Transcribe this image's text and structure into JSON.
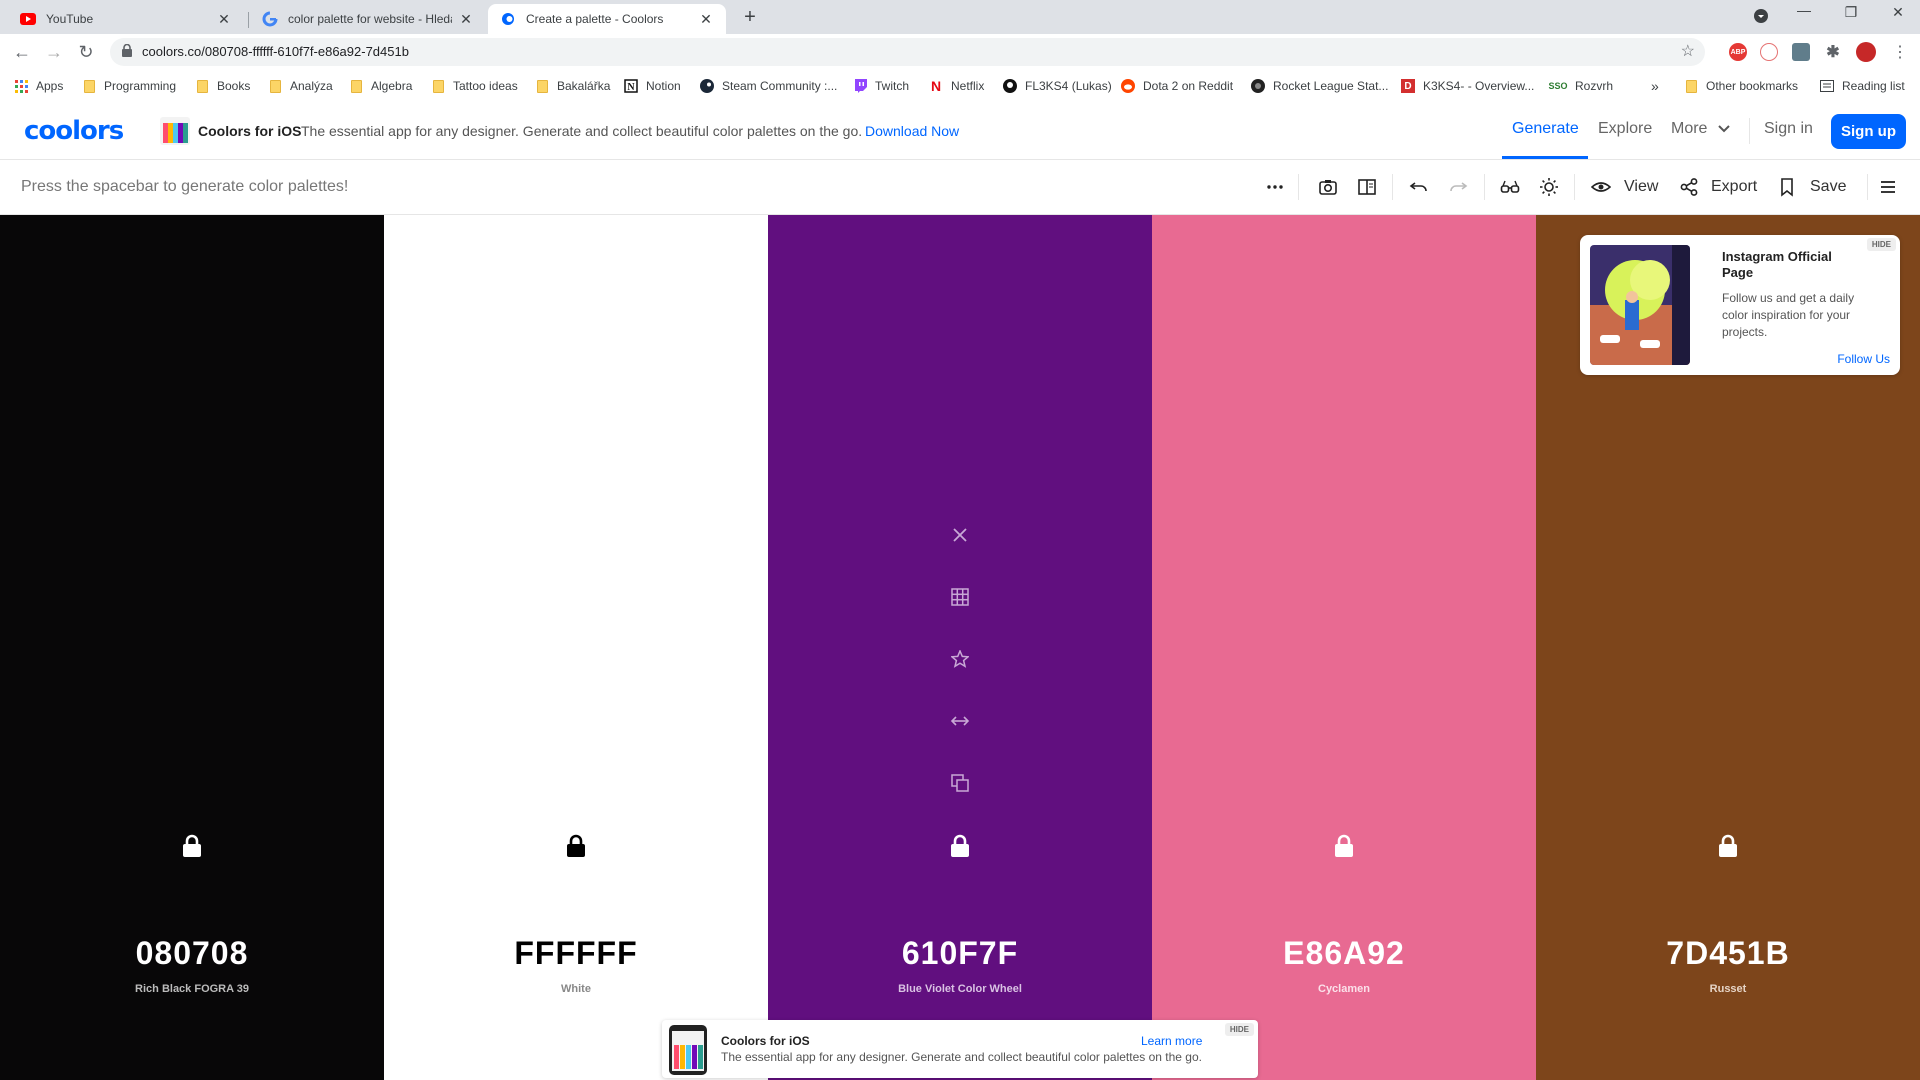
{
  "browser": {
    "tabs": [
      {
        "title": "YouTube",
        "favicon": "youtube-icon",
        "active": false
      },
      {
        "title": "color palette for website - Hledat",
        "favicon": "google-icon",
        "active": false
      },
      {
        "title": "Create a palette - Coolors",
        "favicon": "coolors-icon",
        "active": true
      }
    ],
    "new_tab": "+",
    "url": "coolors.co/080708-ffffff-610f7f-e86a92-7d451b",
    "extensions": [
      "ABP",
      "ext-2",
      "ext-3",
      "puzzle-icon",
      "profile-avatar"
    ],
    "bookmarks": [
      {
        "label": "Apps",
        "icon": "apps-grid-icon"
      },
      {
        "label": "Programming",
        "icon": "folder-icon"
      },
      {
        "label": "Books",
        "icon": "folder-icon"
      },
      {
        "label": "Analýza",
        "icon": "folder-icon"
      },
      {
        "label": "Algebra",
        "icon": "folder-icon"
      },
      {
        "label": "Tattoo ideas",
        "icon": "folder-icon"
      },
      {
        "label": "Bakalářka",
        "icon": "folder-icon"
      },
      {
        "label": "Notion",
        "icon": "notion-icon"
      },
      {
        "label": "Steam Community :...",
        "icon": "steam-icon"
      },
      {
        "label": "Twitch",
        "icon": "twitch-icon"
      },
      {
        "label": "Netflix",
        "icon": "netflix-icon"
      },
      {
        "label": "FL3KS4 (Lukas)",
        "icon": "github-icon"
      },
      {
        "label": "Dota 2 on Reddit",
        "icon": "reddit-icon"
      },
      {
        "label": "Rocket League Stat...",
        "icon": "rocketleague-icon"
      },
      {
        "label": "K3KS4- - Overview...",
        "icon": "d-icon"
      },
      {
        "label": "Rozvrh",
        "icon": "sso-icon"
      }
    ],
    "more_bookmarks": "»",
    "other_bookmarks": "Other bookmarks",
    "reading_list": "Reading list"
  },
  "header": {
    "logo": "coolors",
    "promo_title": "Coolors for iOS",
    "promo_text": "The essential app for any designer. Generate and collect beautiful color palettes on the go.",
    "promo_link": "Download Now",
    "nav": {
      "generate": "Generate",
      "explore": "Explore",
      "more": "More"
    },
    "sign_in": "Sign in",
    "sign_up": "Sign up"
  },
  "toolbar": {
    "hint": "Press the spacebar to generate color palettes!",
    "view_label": "View",
    "export_label": "Export",
    "save_label": "Save"
  },
  "palette": {
    "colors": [
      {
        "hex": "080708",
        "name": "Rich Black FOGRA 39",
        "bg": "#080708",
        "fg": "#ffffff",
        "sub": "#bbbbbb"
      },
      {
        "hex": "FFFFFF",
        "name": "White",
        "bg": "#ffffff",
        "fg": "#000000",
        "sub": "#888888"
      },
      {
        "hex": "610F7F",
        "name": "Blue Violet Color Wheel",
        "bg": "#610f7f",
        "fg": "#ffffff",
        "sub": "#d9c2e3"
      },
      {
        "hex": "E86A92",
        "name": "Cyclamen",
        "bg": "#e86a92",
        "fg": "#ffffff",
        "sub": "#fbe1ea"
      },
      {
        "hex": "7D451B",
        "name": "Russet",
        "bg": "#7d451b",
        "fg": "#ffffff",
        "sub": "#e6d4c6"
      }
    ],
    "hover_icons": [
      "close-icon",
      "shades-grid-icon",
      "favorite-star-icon",
      "drag-arrows-icon",
      "copy-icon"
    ]
  },
  "instagram_ad": {
    "title": "Instagram Official Page",
    "text": "Follow us and get a daily color inspiration for your projects.",
    "link": "Follow Us",
    "hide": "HIDE"
  },
  "bottom_promo": {
    "title": "Coolors for iOS",
    "text": "The essential app for any designer. Generate and collect beautiful color palettes on the go.",
    "link": "Learn more",
    "hide": "HIDE"
  }
}
